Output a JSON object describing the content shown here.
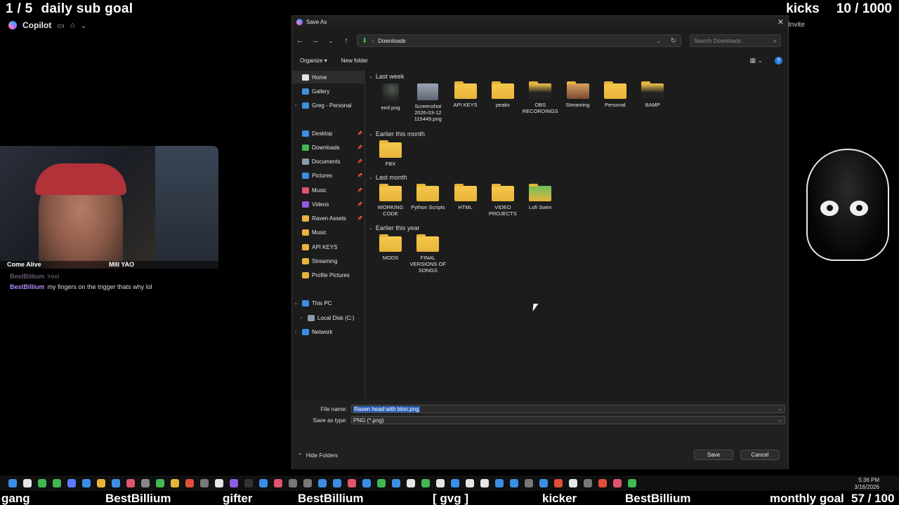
{
  "overlay": {
    "sub_goal": {
      "count": "1 / 5",
      "label": "daily sub goal"
    },
    "kicks_goal": {
      "label": "kicks",
      "count": "10 / 1000"
    },
    "copilot_label": "Copilot",
    "invite_label": "Invite",
    "cam_caption_left": "Come Alive",
    "cam_caption_right": "MIII YAO",
    "chat": [
      {
        "user": "BestBillium",
        "text": "lreel",
        "dim": true
      },
      {
        "user": "BestBillium",
        "text": "my fingers on the trigger thats why lol",
        "dim": false
      }
    ],
    "ticker": [
      {
        "text": "gang"
      },
      {
        "text": "BestBillium"
      },
      {
        "text": "gifter"
      },
      {
        "text": "BestBillium"
      },
      {
        "text": "[ gvg ]"
      },
      {
        "text": "kicker"
      },
      {
        "text": "BestBillium"
      },
      {
        "text": "monthly goal"
      },
      {
        "text": "57 / 100"
      }
    ],
    "clock": {
      "time": "5:36 PM",
      "date": "3/16/2026"
    }
  },
  "dialog": {
    "title": "Save As",
    "address": {
      "location": "Downloads"
    },
    "search_placeholder": "Search Downloads",
    "commands": {
      "organize": "Organize",
      "new_folder": "New folder"
    },
    "sidebar": [
      {
        "label": "Home",
        "icon": "home-icon",
        "color": "#e4e4e4",
        "selected": true
      },
      {
        "label": "Gallery",
        "icon": "gallery-icon",
        "color": "#3d8fd9"
      },
      {
        "label": "Greg - Personal",
        "icon": "cloud-icon",
        "color": "#3d8fd9",
        "expander": true
      },
      {
        "label": "Desktop",
        "icon": "desktop-icon",
        "color": "#3a8ee6",
        "pinned": true
      },
      {
        "label": "Downloads",
        "icon": "download-icon",
        "color": "#3fb950",
        "pinned": true
      },
      {
        "label": "Documents",
        "icon": "documents-icon",
        "color": "#8a9bb0",
        "pinned": true
      },
      {
        "label": "Pictures",
        "icon": "pictures-icon",
        "color": "#3a8ee6",
        "pinned": true
      },
      {
        "label": "Music",
        "icon": "music-icon",
        "color": "#e0556c",
        "pinned": true
      },
      {
        "label": "Videos",
        "icon": "videos-icon",
        "color": "#8f5be0",
        "pinned": true
      },
      {
        "label": "Raven Assets",
        "icon": "folder-icon",
        "color": "#e7b43a",
        "pinned": true
      },
      {
        "label": "Music",
        "icon": "folder-icon",
        "color": "#e7b43a"
      },
      {
        "label": "API KEYS",
        "icon": "folder-icon",
        "color": "#e7b43a"
      },
      {
        "label": "Streaming",
        "icon": "folder-icon",
        "color": "#e7b43a"
      },
      {
        "label": "Profile Pictures",
        "icon": "folder-icon",
        "color": "#e7b43a"
      },
      {
        "label": "This PC",
        "icon": "pc-icon",
        "color": "#3a8ee6",
        "expander": true,
        "expanded": true
      },
      {
        "label": "Local Disk (C:)",
        "icon": "disk-icon",
        "color": "#8a9bb0",
        "expander": true,
        "indent": true
      },
      {
        "label": "Network",
        "icon": "network-icon",
        "color": "#3a8ee6",
        "expander": true
      }
    ],
    "groups": [
      {
        "label": "Last week",
        "items": [
          {
            "name": "emf.png",
            "kind": "png"
          },
          {
            "name": "Screenshot 2026-03-12 115449.png",
            "kind": "shot"
          },
          {
            "name": "API KEYS",
            "kind": "folder"
          },
          {
            "name": "peaks",
            "kind": "folder"
          },
          {
            "name": "OBS RECORDINGS",
            "kind": "folder dark"
          },
          {
            "name": "Streaming",
            "kind": "folder photo"
          },
          {
            "name": "Personal",
            "kind": "folder"
          },
          {
            "name": "BAMP",
            "kind": "folder dark"
          }
        ]
      },
      {
        "label": "Earlier this month",
        "items": [
          {
            "name": "FBX",
            "kind": "folder"
          }
        ]
      },
      {
        "label": "Last month",
        "items": [
          {
            "name": "WORKING CODE",
            "kind": "folder"
          },
          {
            "name": "Python Scripts",
            "kind": "folder"
          },
          {
            "name": "HTML",
            "kind": "folder"
          },
          {
            "name": "VIDEO PROJECTS",
            "kind": "folder"
          },
          {
            "name": "Lofi Swim",
            "kind": "folder green"
          }
        ]
      },
      {
        "label": "Earlier this year",
        "items": [
          {
            "name": "MODS",
            "kind": "folder"
          },
          {
            "name": "FINAL VERSIONS OF SONGS",
            "kind": "folder"
          }
        ]
      }
    ],
    "footer": {
      "file_name_label": "File name:",
      "file_name_value": "Raven head with blon.png",
      "save_type_label": "Save as type:",
      "save_type_value": "PNG (*.png)",
      "hide_folders": "Hide Folders",
      "save": "Save",
      "cancel": "Cancel"
    }
  },
  "taskbar": {
    "icon_colors": [
      "#3a8ee6",
      "#e6e6e6",
      "#3fb950",
      "#3fb950",
      "#5b7cff",
      "#3a8ee6",
      "#e7b43a",
      "#3a8ee6",
      "#e0556c",
      "#888",
      "#3fb950",
      "#e7b43a",
      "#e04f3a",
      "#777",
      "#e6e6e6",
      "#8f5be0",
      "#333",
      "#3a8ee6",
      "#e0556c",
      "#777",
      "#777",
      "#3a8ee6",
      "#3a8ee6",
      "#e0556c",
      "#3a8ee6",
      "#3fb950",
      "#3a8ee6",
      "#e6e6e6",
      "#3fb950",
      "#e6e6e6",
      "#3a8ee6",
      "#e6e6e6",
      "#e6e6e6",
      "#3a8ee6",
      "#3a8ee6",
      "#777",
      "#3a8ee6",
      "#e04f3a",
      "#e6e6e6",
      "#777",
      "#e04f3a",
      "#e0556c",
      "#3fb950"
    ]
  }
}
